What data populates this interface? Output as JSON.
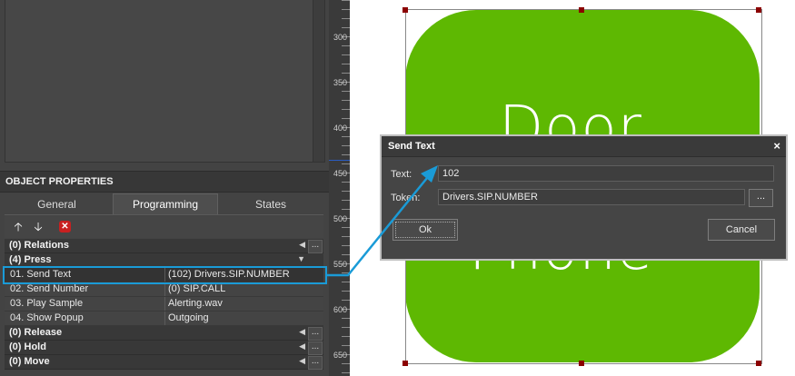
{
  "object_properties": {
    "header": "OBJECT PROPERTIES",
    "tabs": [
      {
        "label": "General"
      },
      {
        "label": "Programming"
      },
      {
        "label": "States"
      }
    ],
    "toolbar": {
      "up_icon": "arrow-up-icon",
      "down_icon": "arrow-down-icon",
      "delete_icon": "delete-icon"
    },
    "groups": {
      "relations": "(0) Relations",
      "press": "(4) Press",
      "release": "(0) Release",
      "hold": "(0) Hold",
      "move": "(0) Move"
    },
    "press_actions": [
      {
        "name": "01. Send Text",
        "value": "(102) Drivers.SIP.NUMBER"
      },
      {
        "name": "02. Send Number",
        "value": "(0) SIP.CALL"
      },
      {
        "name": "03. Play Sample",
        "value": "Alerting.wav"
      },
      {
        "name": "04. Show Popup",
        "value": "Outgoing"
      }
    ],
    "more_button": "..."
  },
  "ruler": {
    "labels": [
      "300",
      "350",
      "400",
      "450",
      "500",
      "550",
      "600",
      "650"
    ]
  },
  "canvas": {
    "tile_color": "#5eb802",
    "tile_line1": "Door",
    "tile_line2": "Phone"
  },
  "dialog": {
    "title": "Send Text",
    "close_symbol": "×",
    "text_label": "Text:",
    "text_value": "102",
    "token_label": "Token:",
    "token_value": "Drivers.SIP.NUMBER",
    "browse_label": "...",
    "ok_label": "Ok",
    "cancel_label": "Cancel"
  },
  "colors": {
    "panel_bg": "#434343",
    "accent_annotation": "#1a9bd7",
    "delete_red": "#c82020"
  }
}
